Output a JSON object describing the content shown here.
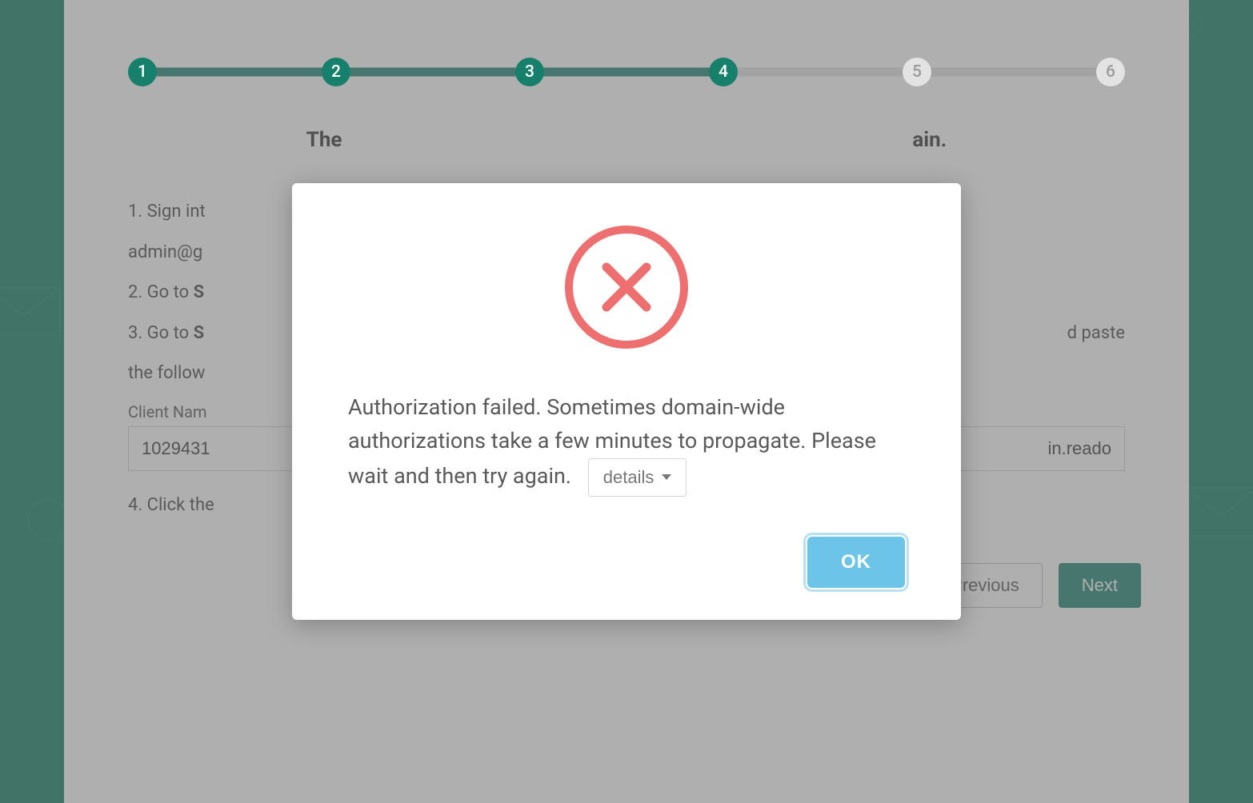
{
  "stepper": {
    "total": 6,
    "current": 4,
    "labels": [
      "1",
      "2",
      "3",
      "4",
      "5",
      "6"
    ]
  },
  "page": {
    "headline_prefix": "The ",
    "headline_suffix": "ain.",
    "step1_prefix": "1. Sign int",
    "step1_line2": "admin@g",
    "step2_prefix": "2. Go to ",
    "step2_bold": "S",
    "step3_prefix": "3. Go to ",
    "step3_bold": "S",
    "step3_tail": "d paste",
    "step3_line2": "the follow",
    "client_name_label": "Client Nam",
    "client_name_value": "1029431",
    "scope_value_tail": "in.reado",
    "step4": "4. Click the",
    "prev_label": "Previous",
    "next_label": "Next"
  },
  "modal": {
    "message": "Authorization failed. Sometimes domain-wide authorizations take a few minutes to propagate. Please wait and then try again.",
    "details_label": "details",
    "ok_label": "OK"
  }
}
